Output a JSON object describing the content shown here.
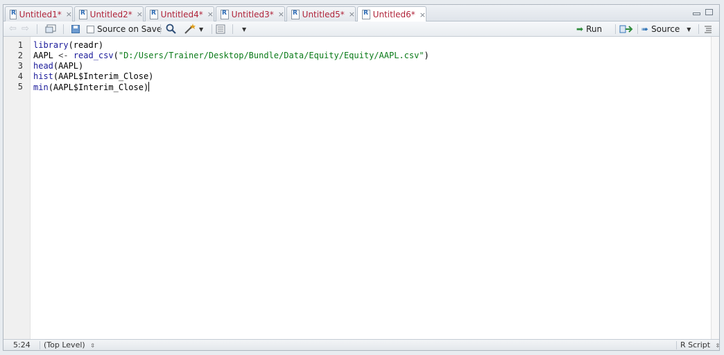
{
  "tabs": [
    {
      "label": "Untitled1*",
      "active": false
    },
    {
      "label": "Untitled2*",
      "active": false
    },
    {
      "label": "Untitled4*",
      "active": false
    },
    {
      "label": "Untitled3*",
      "active": false
    },
    {
      "label": "Untitled5*",
      "active": false
    },
    {
      "label": "Untitled6*",
      "active": true
    }
  ],
  "tab_close_glyph": "×",
  "toolbar": {
    "source_on_save_label": "Source on Save",
    "run_label": "Run",
    "source_label": "Source"
  },
  "editor": {
    "line_numbers": [
      "1",
      "2",
      "3",
      "4",
      "5"
    ],
    "lines": [
      "library(readr)",
      "AAPL <- read_csv(\"D:/Users/Trainer/Desktop/Bundle/Data/Equity/Equity/AAPL.csv\")",
      "head(AAPL)",
      "hist(AAPL$Interim_Close)",
      "min(AAPL$Interim_Close)"
    ]
  },
  "status": {
    "cursor_position": "5:24",
    "scope": "(Top Level)",
    "file_type": "R Script"
  },
  "icons": {
    "tab": "r-document-icon",
    "back": "back-arrow-icon",
    "forward": "forward-arrow-icon",
    "show_in_window": "show-in-window-icon",
    "save": "save-icon",
    "search": "search-icon",
    "code_tools": "magic-wand-icon",
    "compile": "compile-report-icon",
    "run": "run-arrow-icon",
    "rerun": "rerun-icon",
    "source": "source-arrow-icon",
    "outline": "outline-icon"
  },
  "colors": {
    "tab_text": "#b0243a",
    "function": "#1a1a9a",
    "string": "#0a7a18",
    "run_icon": "#2e8b3c",
    "source_icon": "#3577b8"
  }
}
